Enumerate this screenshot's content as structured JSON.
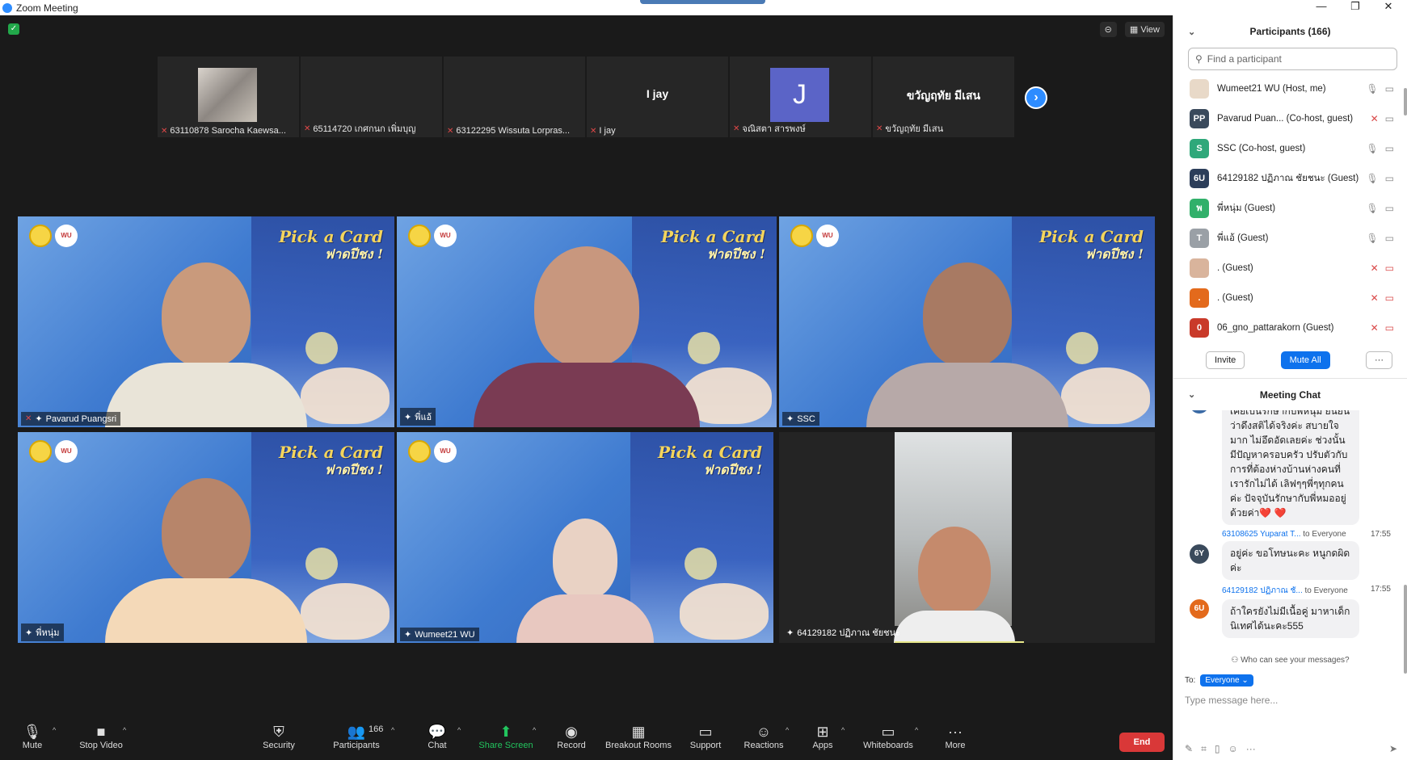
{
  "window": {
    "title": "Zoom Meeting",
    "controls": [
      "—",
      "❐",
      "✕"
    ]
  },
  "stage": {
    "view_label": "View",
    "strip": [
      {
        "name": "63110878 Sarocha Kaewsa...",
        "muted": true,
        "type": "image"
      },
      {
        "name": "65114720 เกศกนก เพิ่มบุญ",
        "muted": true,
        "type": "blank"
      },
      {
        "name": "63122295 Wissuta Lorpras...",
        "muted": true,
        "type": "blank"
      },
      {
        "name": "I jay",
        "muted": true,
        "type": "text",
        "display": "I jay"
      },
      {
        "name": "จณิสตา สารพงษ์",
        "muted": true,
        "type": "avatar",
        "display": "J"
      },
      {
        "name": "ขวัญฤทัย มีเสน",
        "muted": true,
        "type": "text",
        "display": "ขวัญฤทัย มีเสน"
      }
    ],
    "tiles": [
      {
        "name": "Pavarud Puangsri",
        "muted": true,
        "pick": "Pick a Card",
        "pick_sub": "ฟาดปีชง !",
        "wu": "WU"
      },
      {
        "name": "พี่แอ้",
        "muted": false,
        "pick": "Pick a Card",
        "pick_sub": "ฟาดปีชง !",
        "wu": "WU"
      },
      {
        "name": "SSC",
        "muted": false,
        "pick": "Pick a Card",
        "pick_sub": "ฟาดปีชง !",
        "wu": "WU"
      },
      {
        "name": "พี่หนุ่ม",
        "muted": false,
        "pick": "Pick a Card",
        "pick_sub": "ฟาดปีชง !",
        "wu": "WU"
      },
      {
        "name": "Wumeet21 WU",
        "muted": false,
        "pick": "Pick a Card",
        "pick_sub": "ฟาดปีชง !",
        "wu": "WU"
      },
      {
        "name": "64129182 ปฏิภาณ ชัยชนะ",
        "muted": false
      }
    ]
  },
  "toolbar": {
    "mute": "Mute",
    "stop_video": "Stop Video",
    "security": "Security",
    "participants": "Participants",
    "participants_count": "166",
    "chat": "Chat",
    "share_screen": "Share Screen",
    "record": "Record",
    "breakout": "Breakout Rooms",
    "support": "Support",
    "reactions": "Reactions",
    "apps": "Apps",
    "whiteboards": "Whiteboards",
    "more": "More",
    "end": "End"
  },
  "participants": {
    "title": "Participants (166)",
    "search_placeholder": "Find a participant",
    "list": [
      {
        "initials": "",
        "name": "Wumeet21 WU (Host, me)",
        "color": "#e8d9c8",
        "mic_off": false,
        "cam_off": false
      },
      {
        "initials": "PP",
        "name": "Pavarud Puan...  (Co-host, guest)",
        "color": "#3a4a5c",
        "mic_off": true,
        "cam_off": false
      },
      {
        "initials": "S",
        "name": "SSC (Co-host, guest)",
        "color": "#2fa87a",
        "mic_off": false,
        "cam_off": false
      },
      {
        "initials": "6U",
        "name": "64129182 ปฏิภาณ ชัยชนะ (Guest)",
        "color": "#2c3e5a",
        "mic_off": false,
        "cam_off": false
      },
      {
        "initials": "พ",
        "name": "พี่หนุ่ม (Guest)",
        "color": "#31b06a",
        "mic_off": false,
        "cam_off": false
      },
      {
        "initials": "T",
        "name": "พี่แอ้ (Guest)",
        "color": "#9aa0a6",
        "mic_off": false,
        "cam_off": false
      },
      {
        "initials": "",
        "name": ". (Guest)",
        "color": "#d9b49c",
        "mic_off": true,
        "cam_off": true
      },
      {
        "initials": ".",
        "name": ". (Guest)",
        "color": "#e36a1c",
        "mic_off": true,
        "cam_off": true
      },
      {
        "initials": "0",
        "name": "06_gno_pattarakorn (Guest)",
        "color": "#c93a2a",
        "mic_off": true,
        "cam_off": true
      }
    ],
    "invite": "Invite",
    "mute_all": "Mute All",
    "more": "···"
  },
  "chat": {
    "title": "Meeting Chat",
    "messages": [
      {
        "avatar": "6P",
        "color": "#3a6aa5",
        "sender": "",
        "to": "",
        "time": "",
        "text": "เคยเป็นรักษากับพี่หนุ่ม ยืนยันว่าดึงสติได้จริงค่ะ สบายใจมาก ไม่อึดอัดเลยค่ะ ช่วงนั้นมีปัญหาครอบครัว ปรับตัวกับการที่ต้องห่างบ้านห่างคนที่เรารักไม่ได้ เลิฟๆๆพี่ๆทุกคนค่ะ ปัจจุบันรักษากับพี่หมออยู่ด้วยค่า❤️ ❤️"
      },
      {
        "avatar": "6Y",
        "color": "#3a4a5c",
        "sender": "63108625 Yuparat T...",
        "to": "to Everyone",
        "time": "17:55",
        "text": "อยู่ค่ะ ขอโทษนะคะ หนูกดผิดค่ะ"
      },
      {
        "avatar": "6U",
        "color": "#e36a1c",
        "sender": "64129182 ปฏิภาณ ชั...",
        "to": "to Everyone",
        "time": "17:55",
        "text": "ถ้าใครยังไม่มีเนื้อคู่ มาหาเด็กนิเทศได้นะคะ555"
      }
    ],
    "who_can_see": "Who can see your messages?",
    "to_label": "To:",
    "to_value": "Everyone",
    "input_placeholder": "Type message here..."
  }
}
